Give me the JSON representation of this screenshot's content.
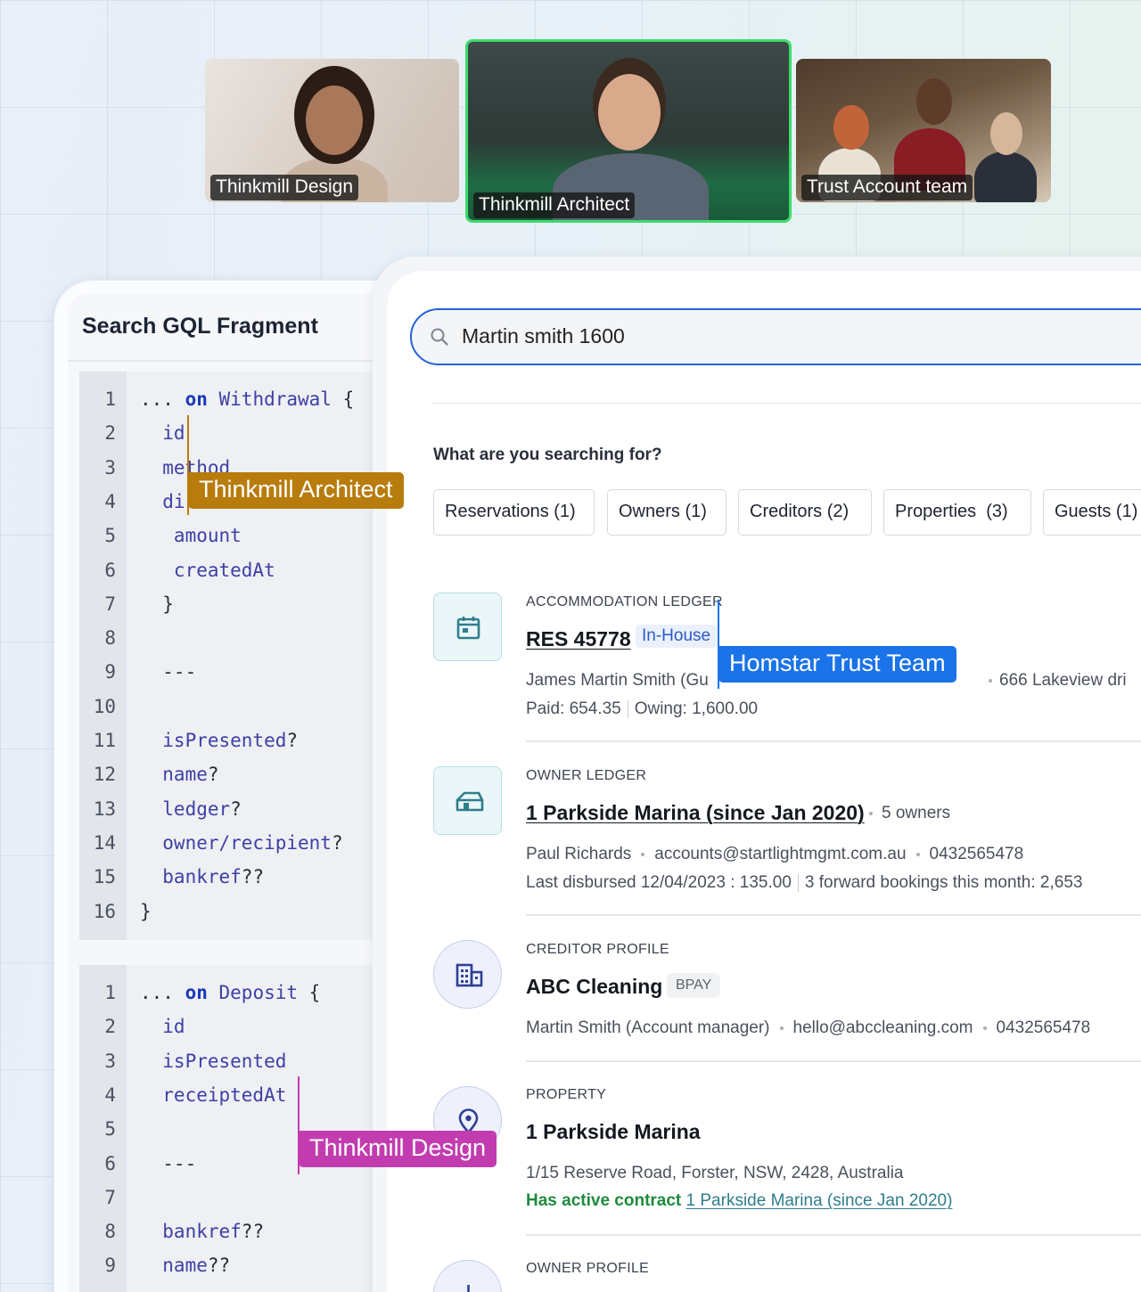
{
  "participants": [
    {
      "name": "Thinkmill Design"
    },
    {
      "name": "Thinkmill Architect"
    },
    {
      "name": "Trust Account team"
    }
  ],
  "code_panel": {
    "title": "Search GQL Fragment",
    "block1": [
      {
        "n": "1",
        "parts": [
          {
            "t": "... ",
            "c": "pu"
          },
          {
            "t": "on",
            "c": "kw"
          },
          {
            "t": " Withdrawal",
            "c": "ty"
          },
          {
            "t": " {",
            "c": "pu"
          }
        ]
      },
      {
        "n": "2",
        "parts": [
          {
            "t": "  id",
            "c": "ty"
          }
        ]
      },
      {
        "n": "3",
        "parts": [
          {
            "t": "  method",
            "c": "ty"
          }
        ]
      },
      {
        "n": "4",
        "parts": [
          {
            "t": "  di",
            "c": "ty"
          }
        ]
      },
      {
        "n": "5",
        "parts": [
          {
            "t": "   amount",
            "c": "ty"
          }
        ]
      },
      {
        "n": "6",
        "parts": [
          {
            "t": "   createdAt",
            "c": "ty"
          }
        ]
      },
      {
        "n": "7",
        "parts": [
          {
            "t": "  }",
            "c": "pu"
          }
        ]
      },
      {
        "n": "8",
        "parts": []
      },
      {
        "n": "9",
        "parts": [
          {
            "t": "  ---",
            "c": "pu"
          }
        ]
      },
      {
        "n": "10",
        "parts": []
      },
      {
        "n": "11",
        "parts": [
          {
            "t": "  isPresented",
            "c": "ty"
          },
          {
            "t": "?",
            "c": "pu"
          }
        ]
      },
      {
        "n": "12",
        "parts": [
          {
            "t": "  name",
            "c": "ty"
          },
          {
            "t": "?",
            "c": "pu"
          }
        ]
      },
      {
        "n": "13",
        "parts": [
          {
            "t": "  ledger",
            "c": "ty"
          },
          {
            "t": "?",
            "c": "pu"
          }
        ]
      },
      {
        "n": "14",
        "parts": [
          {
            "t": "  owner/recipient",
            "c": "ty"
          },
          {
            "t": "?",
            "c": "pu"
          }
        ]
      },
      {
        "n": "15",
        "parts": [
          {
            "t": "  bankref",
            "c": "ty"
          },
          {
            "t": "??",
            "c": "pu"
          }
        ]
      },
      {
        "n": "16",
        "parts": [
          {
            "t": "}",
            "c": "pu"
          }
        ]
      }
    ],
    "block2": [
      {
        "n": "1",
        "parts": [
          {
            "t": "... ",
            "c": "pu"
          },
          {
            "t": "on",
            "c": "kw"
          },
          {
            "t": " Deposit",
            "c": "ty"
          },
          {
            "t": " {",
            "c": "pu"
          }
        ]
      },
      {
        "n": "2",
        "parts": [
          {
            "t": "  id",
            "c": "ty"
          }
        ]
      },
      {
        "n": "3",
        "parts": [
          {
            "t": "  isPresented",
            "c": "ty"
          }
        ]
      },
      {
        "n": "4",
        "parts": [
          {
            "t": "  receiptedAt",
            "c": "ty"
          }
        ]
      },
      {
        "n": "5",
        "parts": []
      },
      {
        "n": "6",
        "parts": [
          {
            "t": "  ---",
            "c": "pu"
          }
        ]
      },
      {
        "n": "7",
        "parts": []
      },
      {
        "n": "8",
        "parts": [
          {
            "t": "  bankref",
            "c": "ty"
          },
          {
            "t": "??",
            "c": "pu"
          }
        ]
      },
      {
        "n": "9",
        "parts": [
          {
            "t": "  name",
            "c": "ty"
          },
          {
            "t": "??",
            "c": "pu"
          }
        ]
      }
    ]
  },
  "search": {
    "value": "Martin smith 1600",
    "prompt": "What are you searching for?",
    "filters": [
      "Reservations (1)",
      "Owners (1)",
      "Creditors (2)",
      "Properties  (3)",
      "Guests (1)"
    ]
  },
  "results": {
    "accommodation": {
      "kind": "ACCOMMODATION LEDGER",
      "title": "RES 45778",
      "badge": "In-House",
      "guest": "James Martin Smith (Gu",
      "address": "666 Lakeview dri",
      "paid": "Paid: 654.35",
      "owing": "Owing: 1,600.00"
    },
    "owner_ledger": {
      "kind": "OWNER LEDGER",
      "title": "1 Parkside Marina (since Jan 2020)",
      "owners": "5 owners",
      "contact": "Paul Richards",
      "email": "accounts@startlightmgmt.com.au",
      "phone": "0432565478",
      "disbursed": "Last disbursed 12/04/2023 : 135.00",
      "bookings": "3 forward bookings this month: 2,653"
    },
    "creditor": {
      "kind": "CREDITOR PROFILE",
      "title": "ABC Cleaning",
      "badge": "BPAY",
      "contact": "Martin Smith (Account manager)",
      "email": "hello@abccleaning.com",
      "phone": "0432565478"
    },
    "property": {
      "kind": "PROPERTY",
      "title": "1 Parkside Marina",
      "address": "1/15 Reserve Road, Forster, NSW, 2428, Australia",
      "contract_label": "Has active contract",
      "contract_link": "1 Parkside Marina (since Jan 2020)"
    },
    "owner_profile": {
      "kind": "OWNER PROFILE"
    }
  },
  "cursors": {
    "architect": {
      "label": "Thinkmill Architect",
      "color": "#b87c0c"
    },
    "homstar": {
      "label": "Homstar Trust Team",
      "color": "#1a73e8"
    },
    "design": {
      "label": "Thinkmill Design",
      "color": "#c23cb0"
    }
  }
}
